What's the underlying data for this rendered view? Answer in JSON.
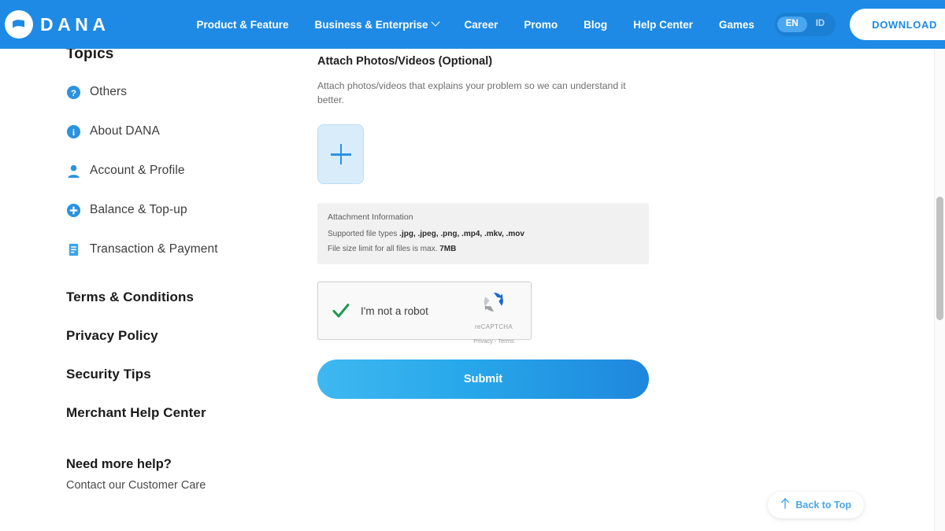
{
  "navbar": {
    "brand_name": "DANA",
    "brand_icon": "dana-logo-icon",
    "links": [
      {
        "label": "Product & Feature",
        "has_caret": false
      },
      {
        "label": "Business & Enterprise",
        "has_caret": true
      },
      {
        "label": "Career",
        "has_caret": false
      },
      {
        "label": "Promo",
        "has_caret": false
      },
      {
        "label": "Blog",
        "has_caret": false
      },
      {
        "label": "Help Center",
        "has_caret": false
      },
      {
        "label": "Games",
        "has_caret": false
      }
    ],
    "language": {
      "options": [
        "EN",
        "ID"
      ],
      "selected": "EN"
    },
    "download_label": "DOWNLOAD",
    "background_color": "#1e8ae5"
  },
  "sidebar": {
    "title": "Topics",
    "topics": [
      {
        "label": "Others",
        "icon": "question-circle-icon"
      },
      {
        "label": "About DANA",
        "icon": "info-circle-icon"
      },
      {
        "label": "Account & Profile",
        "icon": "user-icon"
      },
      {
        "label": "Balance & Top-up",
        "icon": "plus-circle-icon"
      },
      {
        "label": "Transaction & Payment",
        "icon": "document-icon"
      }
    ],
    "links": [
      {
        "label": "Terms & Conditions"
      },
      {
        "label": "Privacy Policy"
      },
      {
        "label": "Security Tips"
      },
      {
        "label": "Merchant Help Center"
      }
    ],
    "help": {
      "title": "Need more help?",
      "subtitle": "Contact our Customer Care"
    }
  },
  "main": {
    "attach": {
      "title": "Attach Photos/Videos (Optional)",
      "description": "Attach photos/videos that explains your problem so we can understand it better.",
      "upload_icon": "plus-icon"
    },
    "attachment_info": {
      "title": "Attachment Information",
      "supported_label": "Supported file types",
      "supported_value": ".jpg, .jpeg, .png, .mp4, .mkv, .mov",
      "size_label": "File size limit for all files is max.",
      "size_value": "7MB"
    },
    "recaptcha": {
      "label": "I'm not a robot",
      "checked": true,
      "brand_name": "reCAPTCHA",
      "terms": "Privacy - Terms",
      "logo_icon": "recaptcha-logo-icon",
      "check_icon": "green-check-icon"
    },
    "submit_label": "Submit",
    "submit_gradient_from": "#3fb8f0",
    "submit_gradient_to": "#1f87dd"
  },
  "back_to_top": {
    "label": "Back to Top",
    "icon": "arrow-up-icon",
    "color": "#4aa6e8"
  },
  "scrollbar": {
    "name": "page-scrollbar"
  }
}
